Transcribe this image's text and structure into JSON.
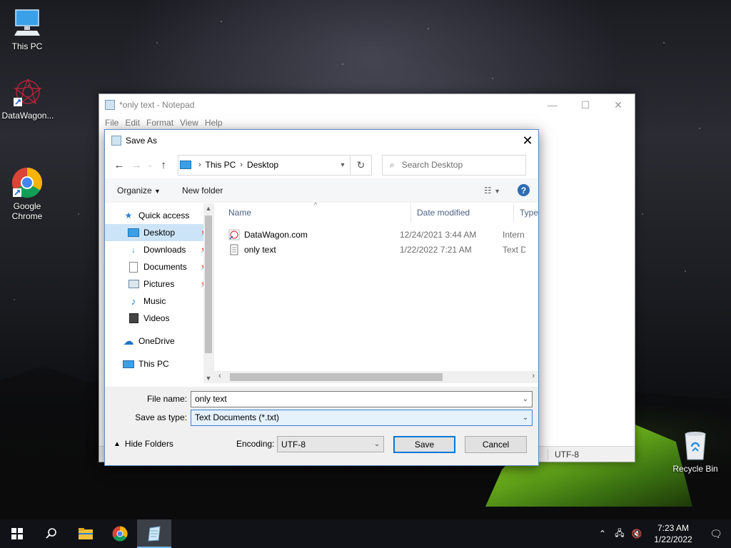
{
  "desktop": {
    "icons": [
      {
        "label": "This PC",
        "icon": "computer-icon"
      },
      {
        "label": "DataWagon...",
        "icon": "datawagon-icon"
      },
      {
        "label": "Google\nChrome",
        "icon": "chrome-icon"
      },
      {
        "label": "Recycle Bin",
        "icon": "recycle-bin-icon"
      }
    ]
  },
  "notepad": {
    "title": "*only text - Notepad",
    "menu": [
      "File",
      "Edit",
      "Format",
      "View",
      "Help"
    ],
    "status_encoding": "UTF-8"
  },
  "dialog": {
    "title": "Save As",
    "breadcrumb": [
      "This PC",
      "Desktop"
    ],
    "search_placeholder": "Search Desktop",
    "toolbar": {
      "organize": "Organize",
      "new_folder": "New folder"
    },
    "nav": [
      {
        "label": "Quick access",
        "icon": "star-icon",
        "top": true
      },
      {
        "label": "Desktop",
        "icon": "desktop-folder-icon",
        "selected": true,
        "pinned": true
      },
      {
        "label": "Downloads",
        "icon": "download-icon",
        "pinned": true
      },
      {
        "label": "Documents",
        "icon": "documents-icon",
        "pinned": true
      },
      {
        "label": "Pictures",
        "icon": "pictures-icon",
        "pinned": true
      },
      {
        "label": "Music",
        "icon": "music-icon"
      },
      {
        "label": "Videos",
        "icon": "videos-icon"
      },
      {
        "label": "OneDrive",
        "icon": "cloud-icon",
        "top": true
      },
      {
        "label": "This PC",
        "icon": "computer-icon",
        "top": true
      }
    ],
    "columns": {
      "name": "Name",
      "date": "Date modified",
      "type": "Type"
    },
    "files": [
      {
        "name": "DataWagon.com",
        "date": "12/24/2021 3:44 AM",
        "type": "Intern",
        "icon": "internet-shortcut-icon"
      },
      {
        "name": "only text",
        "date": "1/22/2022 7:21 AM",
        "type": "Text D",
        "icon": "text-file-icon"
      }
    ],
    "file_name_label": "File name:",
    "file_name_value": "only text",
    "save_type_label": "Save as type:",
    "save_type_value": "Text Documents (*.txt)",
    "hide_folders": "Hide Folders",
    "encoding_label": "Encoding:",
    "encoding_value": "UTF-8",
    "save_button": "Save",
    "cancel_button": "Cancel"
  },
  "taskbar": {
    "time": "7:23 AM",
    "date": "1/22/2022"
  },
  "colors": {
    "accent": "#0078d7",
    "selection": "#cce4f7",
    "taskbar": "#101217"
  }
}
